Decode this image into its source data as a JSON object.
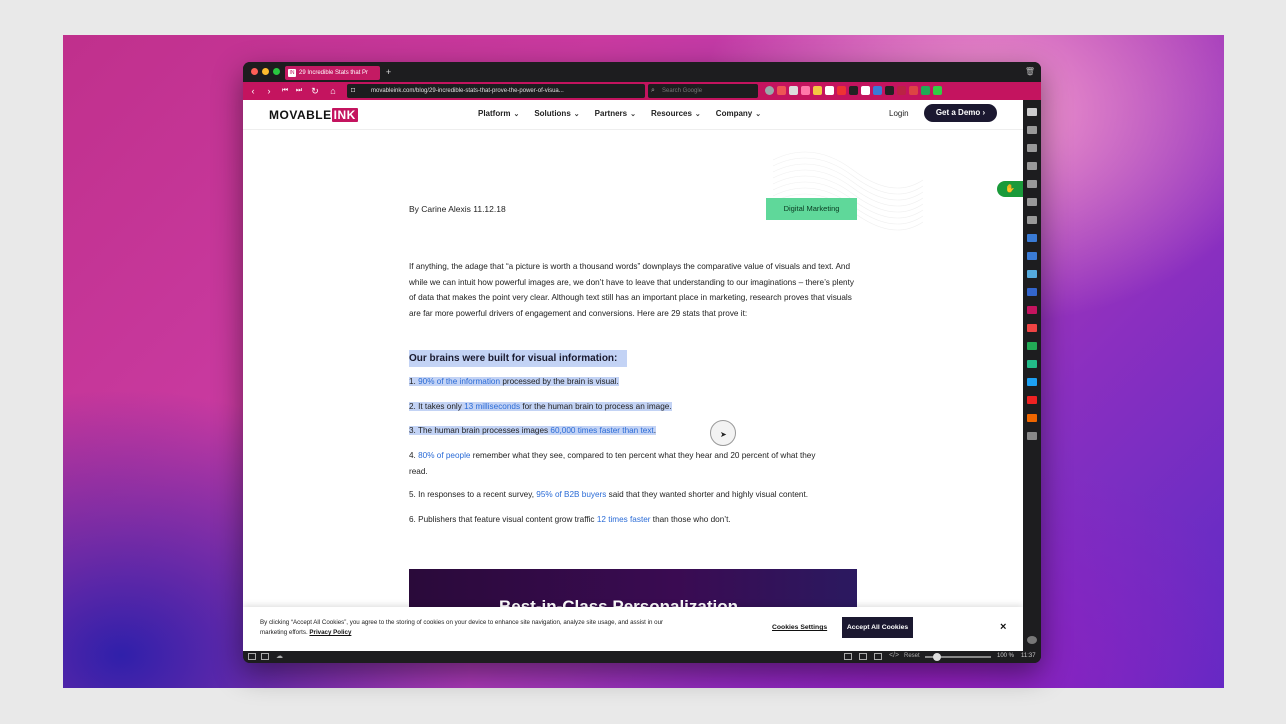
{
  "browser": {
    "tab_title": "29 Incredible Stats that Pr",
    "tab_favicon": "IN",
    "url": "movableink.com/blog/29-incredible-stats-that-prove-the-power-of-visua...",
    "search_placeholder": "Search Google",
    "zoom": "100 %",
    "reset_label": "Reset",
    "clock": "11:37"
  },
  "site": {
    "logo_main": "MOVABLE",
    "logo_ink": "INK",
    "nav": [
      {
        "label": "Platform"
      },
      {
        "label": "Solutions"
      },
      {
        "label": "Partners"
      },
      {
        "label": "Resources"
      },
      {
        "label": "Company"
      }
    ],
    "login": "Login",
    "demo": "Get a Demo"
  },
  "article": {
    "byline": "By Carine Alexis  11.12.18",
    "tag": "Digital Marketing",
    "intro": "If anything, the adage that “a picture is worth a thousand words” downplays the comparative value of visuals and text. And while we can intuit how powerful images are, we don’t have to leave that understanding to our imaginations – there’s plenty of data that makes the point very clear. Although text still has an important place in marketing, research proves that visuals are far more powerful drivers of engagement and conversions. Here are 29 stats that prove it:",
    "heading": "Our brains were built for visual information:",
    "stats": [
      {
        "pre": "1. ",
        "link": "90% of the information",
        "post": " processed by the brain is visual."
      },
      {
        "pre": "2. It takes only ",
        "link": "13 milliseconds",
        "post": " for the human brain to process an image."
      },
      {
        "pre": "3. The human brain processes images ",
        "link": "60,000 times faster than text",
        "post": "."
      },
      {
        "pre": "4. ",
        "link": "80% of people",
        "post": " remember what they see, compared to ten percent what they hear and 20 percent of what they read."
      },
      {
        "pre": "5. In responses to a recent survey, ",
        "link": "95% of B2B buyers",
        "post": " said that they wanted shorter and highly visual content."
      },
      {
        "pre": "6. Publishers that feature visual content grow traffic ",
        "link": "12 times faster",
        "post": " than those who don’t."
      }
    ],
    "banner_text": "Best-in-Class Personalization"
  },
  "cookie": {
    "text": "By clicking “Accept All Cookies”, you agree to the storing of cookies on your device to enhance site navigation, analyze site usage, and assist in our marketing efforts.",
    "policy": "Privacy Policy",
    "settings": "Cookies Settings",
    "accept": "Accept All Cookies",
    "close": "×"
  },
  "colors": {
    "brand_pink": "#c4145f",
    "tag_green": "#5fd89a",
    "link_blue": "#2a6bd6",
    "highlight": "#c3d3f5"
  }
}
